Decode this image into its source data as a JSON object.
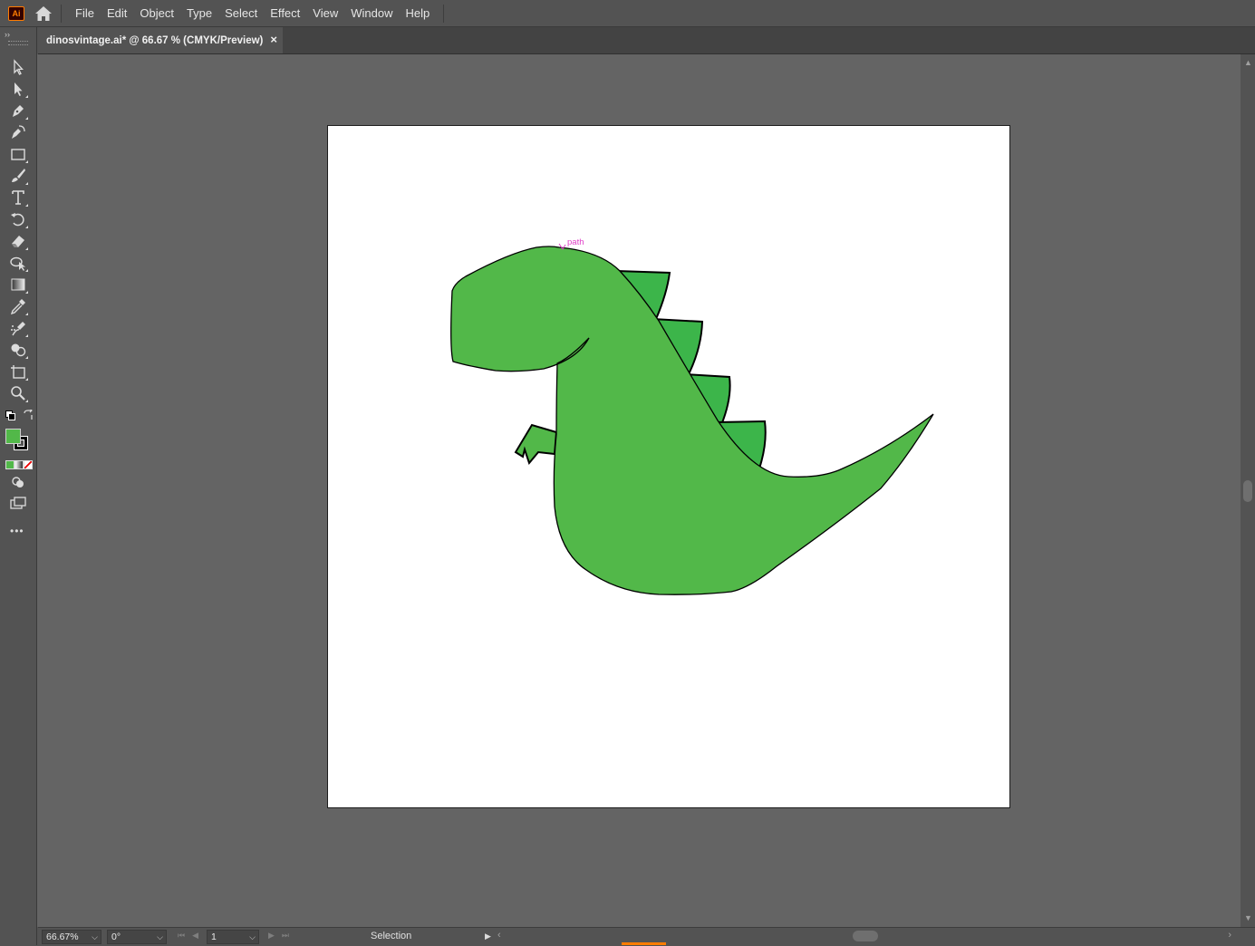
{
  "app": {
    "logo_text": "Ai",
    "menu": [
      "File",
      "Edit",
      "Object",
      "Type",
      "Select",
      "Effect",
      "View",
      "Window",
      "Help"
    ]
  },
  "document": {
    "tab_title": "dinosvintage.ai* @ 66.67 % (CMYK/Preview)",
    "close_symbol": "×"
  },
  "canvas": {
    "hover_label": "path",
    "colors": {
      "dino_body": "#52b849",
      "dino_spikes": "#3cb54a",
      "outline": "#000000",
      "smart_guide": "#e040c8"
    }
  },
  "toolbar": {
    "tools": [
      "selection-tool",
      "direct-selection-tool",
      "pen-tool",
      "curvature-tool",
      "rectangle-tool",
      "paintbrush-tool",
      "type-tool",
      "rotate-tool",
      "eraser-tool",
      "puppet-warp-tool",
      "gradient-tool",
      "eyedropper-tool",
      "symbol-sprayer-tool",
      "shape-builder-tool",
      "artboard-tool",
      "zoom-tool"
    ],
    "fill_color": "#52b849",
    "stroke_color": "#000000",
    "more_label": "•••"
  },
  "statusbar": {
    "zoom": "66.67%",
    "rotation": "0°",
    "artboard_number": "1",
    "status_text": "Selection"
  }
}
